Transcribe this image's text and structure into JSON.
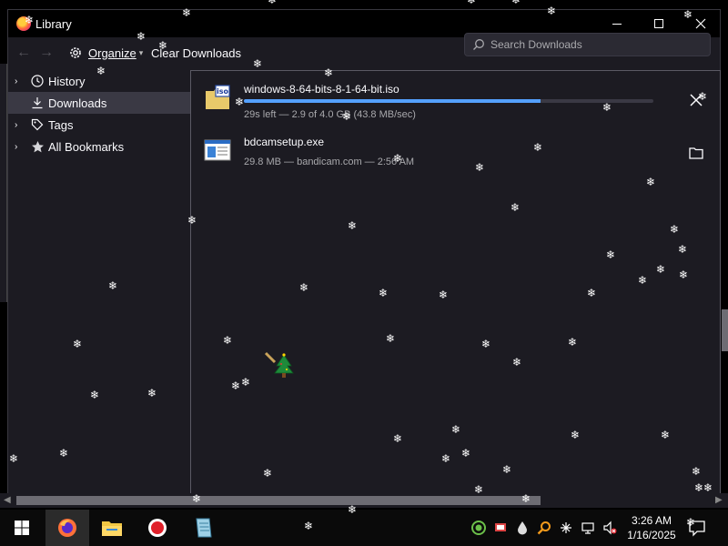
{
  "window": {
    "title": "Library",
    "controls": [
      "minimize",
      "maximize",
      "close"
    ]
  },
  "toolbar": {
    "organize_label": "Organize",
    "clear_label": "Clear Downloads",
    "search_placeholder": "Search Downloads"
  },
  "sidebar": {
    "items": [
      {
        "label": "History",
        "icon": "clock-icon",
        "expandable": true,
        "selected": false
      },
      {
        "label": "Downloads",
        "icon": "download-icon",
        "expandable": false,
        "selected": true
      },
      {
        "label": "Tags",
        "icon": "tag-icon",
        "expandable": true,
        "selected": false
      },
      {
        "label": "All Bookmarks",
        "icon": "star-icon",
        "expandable": true,
        "selected": false
      }
    ]
  },
  "downloads": [
    {
      "name": "windows-8-64-bits-8-1-64-bit.iso",
      "status": "29s left — 2.9 of 4.0 GB (43.8 MB/sec)",
      "progress": 0.725,
      "icon": "iso-file-icon",
      "action": "cancel-icon"
    },
    {
      "name": "bdcamsetup.exe",
      "status": "29.8 MB — bandicam.com — 2:56 AM",
      "icon": "exe-file-icon",
      "action": "folder-icon"
    }
  ],
  "taskbar": {
    "apps": [
      "windows-start-icon",
      "firefox-icon",
      "file-explorer-icon",
      "bandicam-icon",
      "notepad-icon"
    ],
    "clock_time": "3:26 AM",
    "clock_date": "1/16/2025"
  },
  "colors": {
    "window_bg": "#1c1b22",
    "selected_bg": "#3a3944",
    "progress": "#54a0ff",
    "text": "#fbfbfe",
    "muted_text": "#a9a9ad"
  }
}
